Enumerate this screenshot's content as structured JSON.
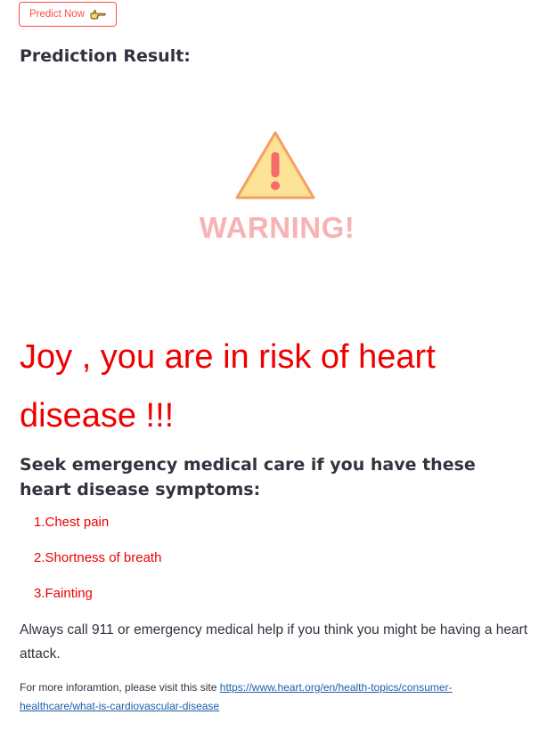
{
  "button": {
    "label": "Predict Now",
    "icon": "pointing-hand-icon",
    "accent_color": "#ff4b4b"
  },
  "result": {
    "heading": "Prediction Result:",
    "warning_text": "WARNING!",
    "warning_icon": "warning-triangle-icon",
    "risk_message": "Joy , you are in risk of heart disease !!!",
    "risk_color": "#ee0000"
  },
  "symptoms": {
    "heading": "Seek emergency medical care if you have these heart disease symptoms:",
    "items": [
      "1.Chest pain",
      "2.Shortness of breath",
      "3.Fainting"
    ]
  },
  "advice": "Always call 911 or emergency medical help if you think you might be having a heart attack.",
  "more_info": {
    "prefix": "For more inforamtion, please visit this site",
    "link_text": "https://www.heart.org/en/health-topics/consumer-healthcare/what-is-cardiovascular-disease"
  }
}
